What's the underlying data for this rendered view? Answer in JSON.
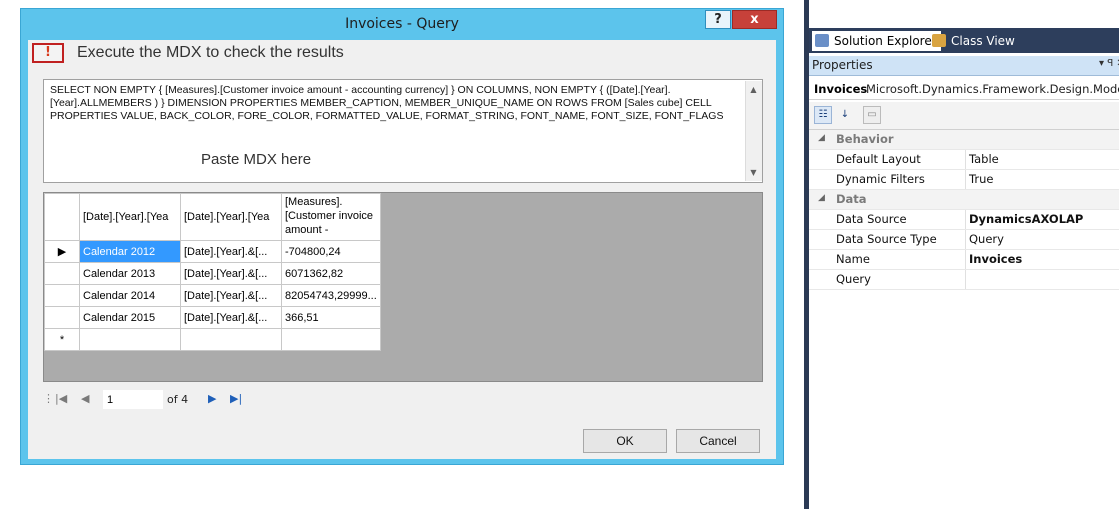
{
  "dialog": {
    "title": "Invoices - Query",
    "help_label": "?",
    "close_label": "x",
    "execute_icon": "exclamation-icon",
    "execute_label": "Execute the MDX to check the results",
    "mdx_text": "SELECT NON EMPTY { [Measures].[Customer invoice amount - accounting currency] } ON COLUMNS, NON EMPTY { ([Date].[Year].[Year].ALLMEMBERS ) } DIMENSION PROPERTIES MEMBER_CAPTION, MEMBER_UNIQUE_NAME ON ROWS FROM [Sales cube] CELL PROPERTIES VALUE, BACK_COLOR, FORE_COLOR, FORMATTED_VALUE, FORMAT_STRING, FONT_NAME, FONT_SIZE, FONT_FLAGS",
    "mdx_hint": "Paste MDX here",
    "grid": {
      "headers": [
        "[Date].[Year].[Yea",
        "[Date].[Year].[Yea",
        "[Measures].[Customer invoice amount - accounting"
      ],
      "rows": [
        [
          "Calendar 2012",
          "[Date].[Year].&[...",
          "-704800,24"
        ],
        [
          "Calendar 2013",
          "[Date].[Year].&[...",
          "6071362,82"
        ],
        [
          "Calendar 2014",
          "[Date].[Year].&[...",
          "82054743,29999..."
        ],
        [
          "Calendar 2015",
          "[Date].[Year].&[...",
          "366,51"
        ]
      ],
      "current_row_marker": "▶",
      "new_row_marker": "*"
    },
    "nav": {
      "page": "1",
      "of_label": "of 4"
    },
    "ok_label": "OK",
    "cancel_label": "Cancel"
  },
  "right_panel": {
    "tabs": [
      {
        "label": "Solution Explorer",
        "icon": "solution-explorer-icon"
      },
      {
        "label": "Class View",
        "icon": "class-view-icon"
      }
    ],
    "properties": {
      "title": "Properties",
      "pin_label": "▾ ꟼ ✕",
      "object_name": "Invoices",
      "object_type": "Microsoft.Dynamics.Framework.Design.Model.",
      "categories": [
        {
          "name": "Behavior",
          "items": [
            {
              "name": "Default Layout",
              "value": "Table"
            },
            {
              "name": "Dynamic Filters",
              "value": "True"
            }
          ]
        },
        {
          "name": "Data",
          "items": [
            {
              "name": "Data Source",
              "value": "DynamicsAXOLAP"
            },
            {
              "name": "Data Source Type",
              "value": "Query"
            },
            {
              "name": "Name",
              "value": "Invoices"
            },
            {
              "name": "Query",
              "value": ""
            }
          ]
        }
      ]
    }
  }
}
